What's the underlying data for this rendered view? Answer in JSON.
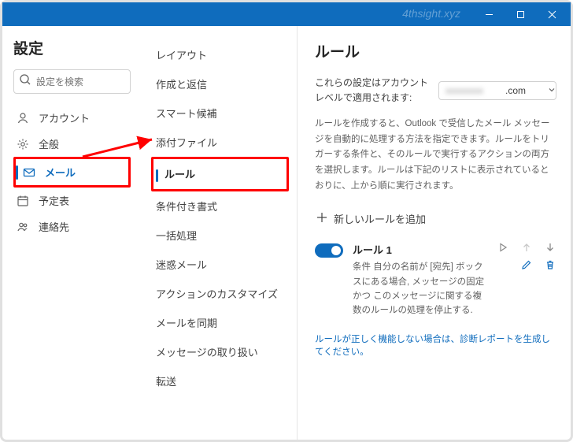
{
  "watermark": "4thsight.xyz",
  "col1": {
    "title": "設定",
    "search_placeholder": "設定を検索",
    "items": [
      {
        "label": "アカウント",
        "icon": "person"
      },
      {
        "label": "全般",
        "icon": "gear"
      },
      {
        "label": "メール",
        "icon": "mail",
        "selected": true
      },
      {
        "label": "予定表",
        "icon": "calendar"
      },
      {
        "label": "連絡先",
        "icon": "contacts"
      }
    ]
  },
  "col2": {
    "items": [
      "レイアウト",
      "作成と返信",
      "スマート候補",
      "添付ファイル",
      "ルール",
      "条件付き書式",
      "一括処理",
      "迷惑メール",
      "アクションのカスタマイズ",
      "メールを同期",
      "メッセージの取り扱い",
      "転送"
    ],
    "selected_index": 4
  },
  "col3": {
    "title": "ルール",
    "account_label": "これらの設定はアカウント レベルで適用されます:",
    "account_value": ".com",
    "description": "ルールを作成すると、Outlook で受信したメール メッセージを自動的に処理する方法を指定できます。ルールをトリガーする条件と、そのルールで実行するアクションの両方を選択します。ルールは下記のリストに表示されているとおりに、上から順に実行されます。",
    "add_rule_label": "新しいルールを追加",
    "rule": {
      "name": "ルール 1",
      "detail": "条件 自分の名前が [宛先] ボックスにある場合, メッセージの固定 かつ このメッセージに関する複数のルールの処理を停止する."
    },
    "diagnostic_link": "ルールが正しく機能しない場合は、診断レポートを生成してください。"
  }
}
